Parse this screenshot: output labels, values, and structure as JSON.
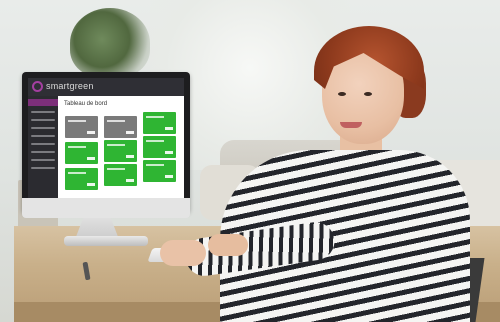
{
  "screen": {
    "brand": "smartgreen",
    "title": "Tableau de bord"
  },
  "colors": {
    "brand_purple": "#a43fa0",
    "tile_green": "#2fb533",
    "tile_gray": "#7a7a7a",
    "topbar": "#2f2f35"
  },
  "icons": [
    "smartgreen-logo-icon"
  ]
}
